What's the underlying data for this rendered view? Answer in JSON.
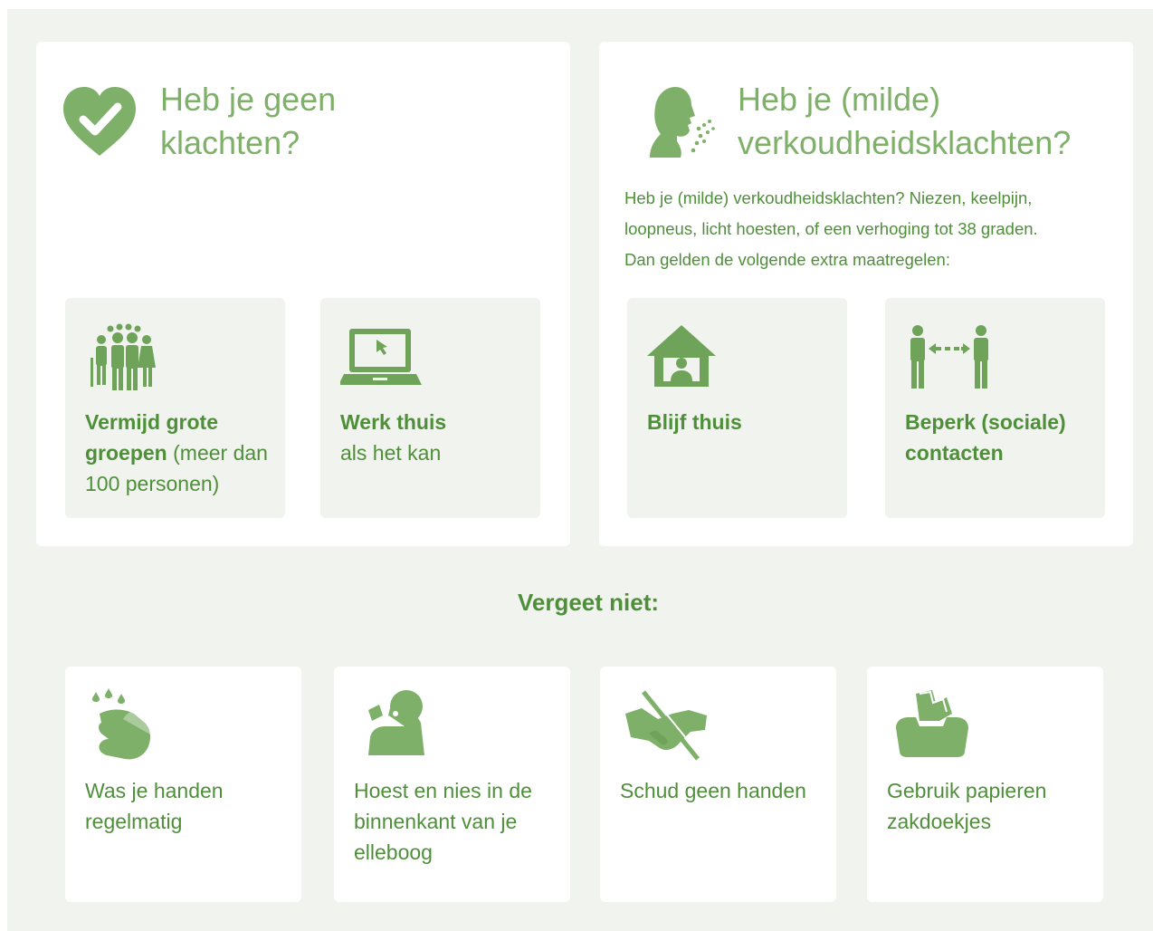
{
  "left_panel": {
    "title_line1": "Heb je geen",
    "title_line2": "klachten?",
    "icon": "heart-check-icon",
    "tiles": [
      {
        "icon": "group-of-people-icon",
        "bold": "Vermijd grote groepen",
        "text": " (meer dan 100 personen)"
      },
      {
        "icon": "laptop-icon",
        "bold": "Werk thuis",
        "text": "als het kan"
      }
    ]
  },
  "right_panel": {
    "title_line1": "Heb je (milde)",
    "title_line2": "verkoudheidsklachten?",
    "icon": "sneezing-person-icon",
    "intro_line1": "Heb je (milde) verkoudheidsklachten? Niezen, keelpijn,",
    "intro_line2": "loopneus, licht hoesten, of een verhoging tot 38 graden.",
    "intro_line3": "Dan gelden de volgende extra maatregelen:",
    "tiles": [
      {
        "icon": "house-person-icon",
        "bold": "Blijf thuis"
      },
      {
        "icon": "distance-people-icon",
        "bold_line1": "Beperk (sociale)",
        "bold_line2": "contacten"
      }
    ]
  },
  "section_title": "Vergeet niet:",
  "cards": [
    {
      "icon": "wash-hands-icon",
      "line1": "Was je handen",
      "line2": "regelmatig"
    },
    {
      "icon": "cough-elbow-icon",
      "line1": "Hoest en nies in de",
      "line2": "binnenkant van je",
      "line3": "elleboog"
    },
    {
      "icon": "no-handshake-icon",
      "line1": "Schud geen handen"
    },
    {
      "icon": "tissue-box-icon",
      "line1": "Gebruik papieren",
      "line2": "zakdoekjes"
    }
  ],
  "colors": {
    "background": "#f1f3ee",
    "panel": "#ffffff",
    "text_green": "#4f8f3a",
    "light_green": "#7fb069",
    "icon_green": "#6fa35a"
  }
}
